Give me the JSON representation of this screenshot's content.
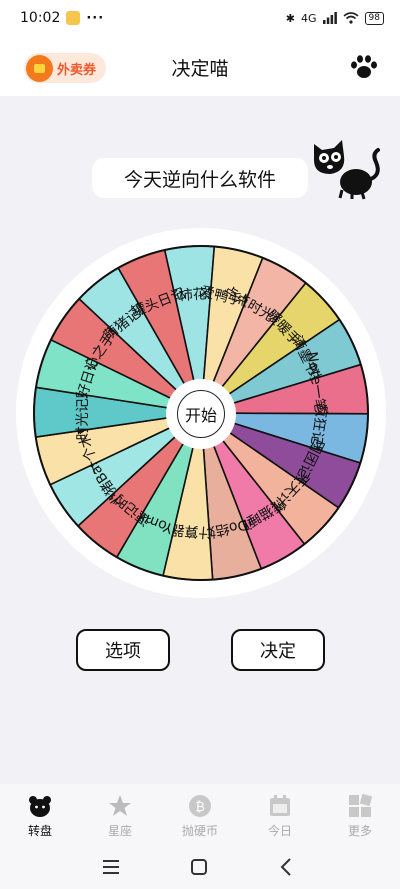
{
  "status": {
    "time": "10:02",
    "more": "···",
    "network": "4G",
    "battery": "98"
  },
  "header": {
    "coupon_label": "外卖券",
    "title": "决定喵"
  },
  "question": "今天逆向什么软件",
  "wheel": {
    "start_label": "开始",
    "segments": [
      {
        "label": "好柿花生",
        "color": "#9ee4e4"
      },
      {
        "label": "爱鸭手帐",
        "color": "#f9e1a8"
      },
      {
        "label": "点点时光手帐",
        "color": "#f3b6a6"
      },
      {
        "label": "暖暖手帐",
        "color": "#e6d56b"
      },
      {
        "label": "滴墨书摘",
        "color": "#7fc9d2"
      },
      {
        "label": "Note一笔刷题",
        "color": "#ea6f8c"
      },
      {
        "label": "疯狂记账",
        "color": "#7ab8e2"
      },
      {
        "label": "团团记账",
        "color": "#8e4c9a"
      },
      {
        "label": "天天计时",
        "color": "#f2b29c"
      },
      {
        "label": "熊猫睡眠",
        "color": "#f07aa8"
      },
      {
        "label": "iDo结婚",
        "color": "#e8b09c"
      },
      {
        "label": "计算器",
        "color": "#f9e1a8"
      },
      {
        "label": "Yomi",
        "color": "#80e2c0"
      },
      {
        "label": "速记时钟",
        "color": "#e87676"
      },
      {
        "label": "小猪Base",
        "color": "#a0e6e4"
      },
      {
        "label": "一个木鱼",
        "color": "#f9e1a8"
      },
      {
        "label": "时光记账",
        "color": "#5fc8c8"
      },
      {
        "label": "好日记",
        "color": "#7fe3c8"
      },
      {
        "label": "心之手帐",
        "color": "#e87676"
      },
      {
        "label": "萌猪记账",
        "color": "#9ee4e4"
      },
      {
        "label": "罐头日记",
        "color": "#e87676"
      }
    ]
  },
  "buttons": {
    "options": "选项",
    "decide": "决定"
  },
  "tabs": [
    {
      "label": "转盘",
      "icon": "bear-icon",
      "active": true
    },
    {
      "label": "星座",
      "icon": "star-icon",
      "active": false
    },
    {
      "label": "抛硬币",
      "icon": "coin-icon",
      "active": false
    },
    {
      "label": "今日",
      "icon": "calendar-icon",
      "active": false
    },
    {
      "label": "更多",
      "icon": "grid-icon",
      "active": false
    }
  ]
}
